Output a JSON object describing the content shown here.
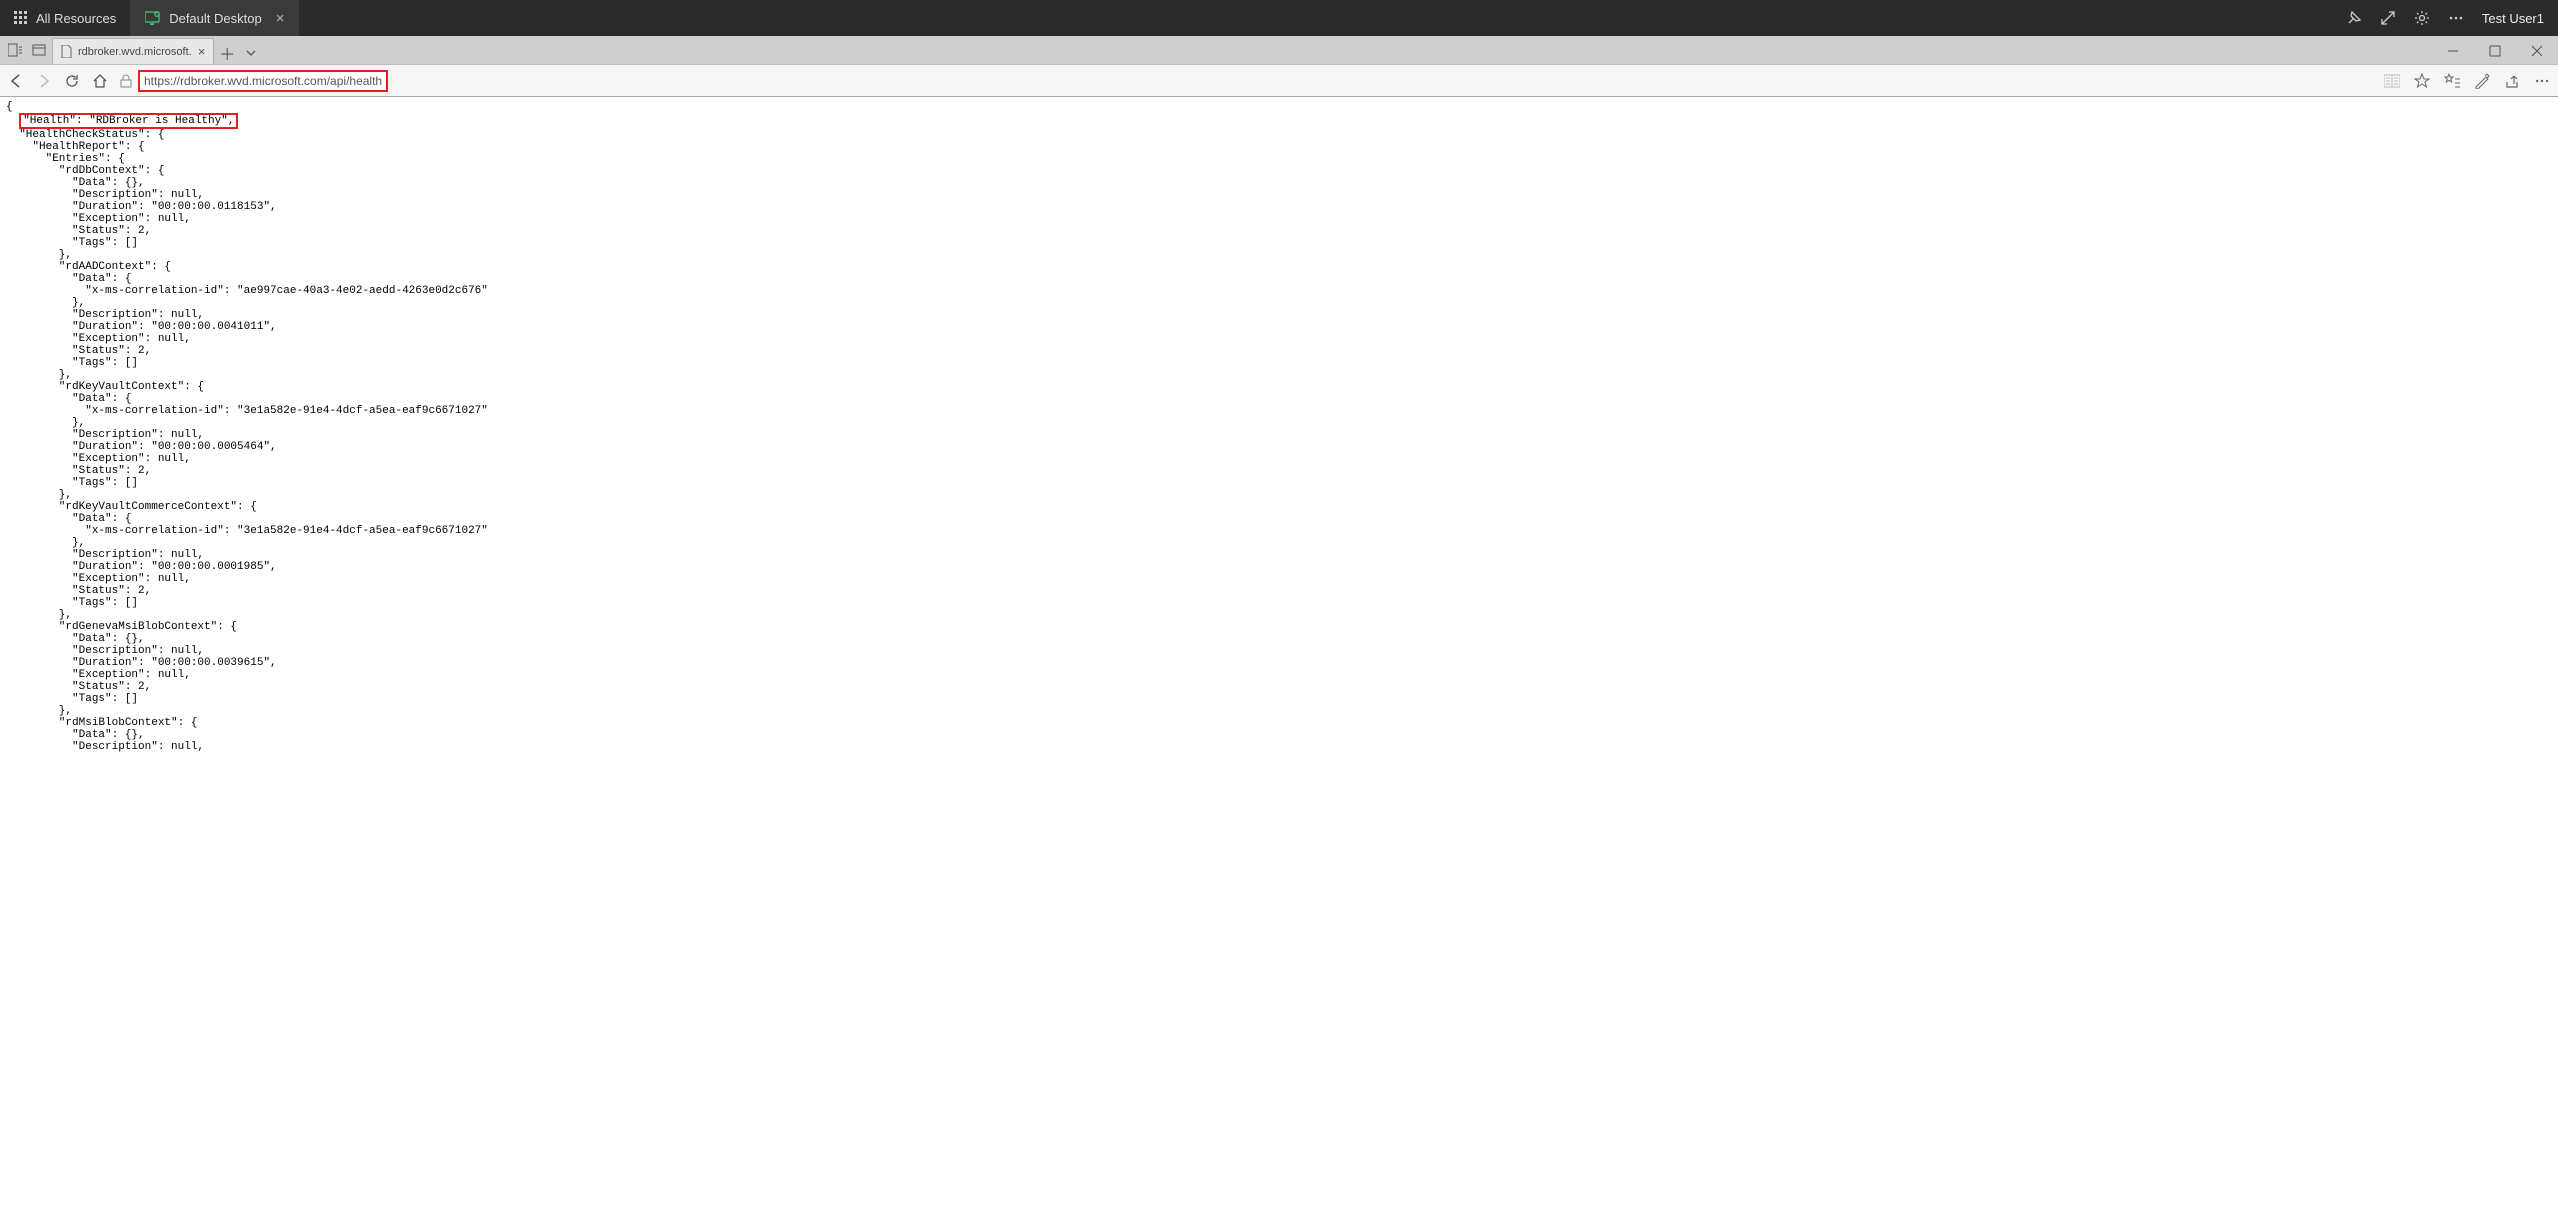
{
  "rd_bar": {
    "tabs": [
      {
        "label": "All Resources"
      },
      {
        "label": "Default Desktop",
        "active": true
      }
    ],
    "user": "Test User1"
  },
  "browser": {
    "tab_title": "rdbroker.wvd.microsoft.",
    "url": "https://rdbroker.wvd.microsoft.com/api/health"
  },
  "highlight_line": "\"Health\": \"RDBroker is Healthy\",",
  "json_response": {
    "Health": "RDBroker is Healthy",
    "HealthCheckStatus": {
      "HealthReport": {
        "Entries": {
          "rdDbContext": {
            "Data": {},
            "Description": null,
            "Duration": "00:00:00.0118153",
            "Exception": null,
            "Status": 2,
            "Tags": []
          },
          "rdAADContext": {
            "Data": {
              "x-ms-correlation-id": "ae997cae-40a3-4e02-aedd-4263e0d2c676"
            },
            "Description": null,
            "Duration": "00:00:00.0041011",
            "Exception": null,
            "Status": 2,
            "Tags": []
          },
          "rdKeyVaultContext": {
            "Data": {
              "x-ms-correlation-id": "3e1a582e-91e4-4dcf-a5ea-eaf9c6671027"
            },
            "Description": null,
            "Duration": "00:00:00.0005464",
            "Exception": null,
            "Status": 2,
            "Tags": []
          },
          "rdKeyVaultCommerceContext": {
            "Data": {
              "x-ms-correlation-id": "3e1a582e-91e4-4dcf-a5ea-eaf9c6671027"
            },
            "Description": null,
            "Duration": "00:00:00.0001985",
            "Exception": null,
            "Status": 2,
            "Tags": []
          },
          "rdGenevaMsiBlobContext": {
            "Data": {},
            "Description": null,
            "Duration": "00:00:00.0039615",
            "Exception": null,
            "Status": 2,
            "Tags": []
          },
          "rdMsiBlobContext": {
            "Data": {},
            "Description": null
          }
        }
      }
    }
  }
}
